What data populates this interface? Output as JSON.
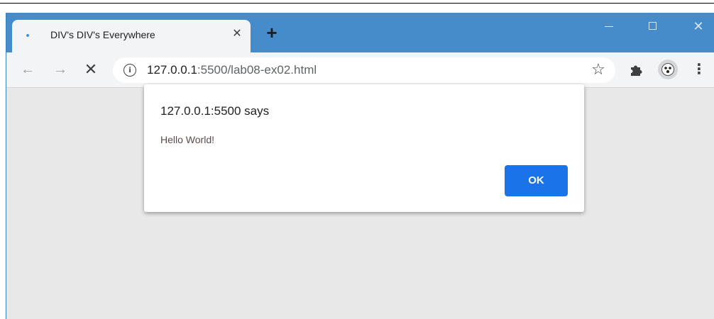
{
  "tab": {
    "title": "DIV's DIV's Everywhere",
    "close_glyph": "✕",
    "new_tab_glyph": "+"
  },
  "window_controls": {
    "minimize": "minimize",
    "maximize": "maximize",
    "close_glyph": "✕"
  },
  "toolbar": {
    "back_glyph": "←",
    "forward_glyph": "→",
    "stop_glyph": "✕",
    "info_glyph": "i",
    "url_host": "127.0.0.1",
    "url_rest": ":5500/lab08-ex02.html",
    "star_glyph": "☆",
    "menu_glyph": "⋮"
  },
  "icons": {
    "extensions": "puzzle-icon",
    "profile": "avatar-icon"
  },
  "dialog": {
    "title": "127.0.0.1:5500 says",
    "message": "Hello World!",
    "ok_label": "OK"
  },
  "colors": {
    "titlebar": "#468cca",
    "ok_button": "#1a73e8",
    "page_background": "#e8e8e8"
  }
}
